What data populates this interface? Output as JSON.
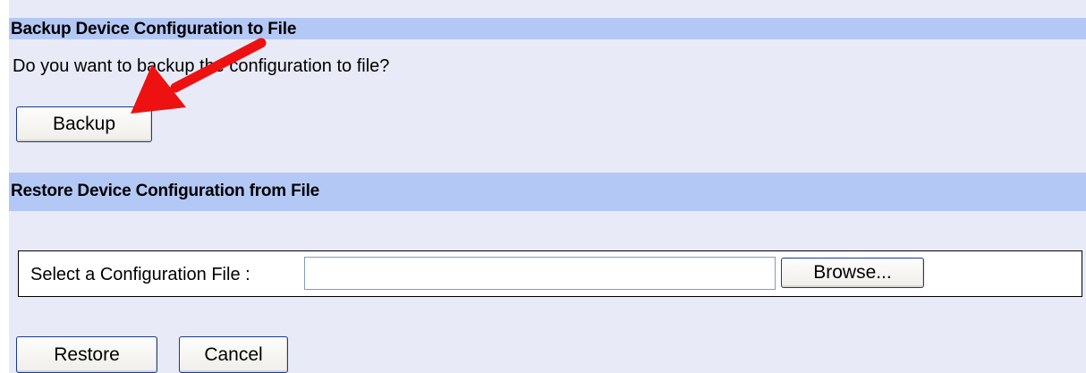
{
  "backup_section": {
    "header": "Backup Device Configuration to File",
    "question": "Do you want to backup the configuration to file?",
    "backup_button_label": "Backup"
  },
  "restore_section": {
    "header": "Restore Device Configuration from File",
    "file_label": "Select a Configuration File :",
    "file_value": "",
    "browse_button_label": "Browse...",
    "restore_button_label": "Restore",
    "cancel_button_label": "Cancel"
  },
  "annotation": {
    "icon": "red-arrow-icon",
    "color": "#ee1111"
  },
  "colors": {
    "header_background": "#b4c8f5",
    "panel_background": "#e8ebf7"
  }
}
